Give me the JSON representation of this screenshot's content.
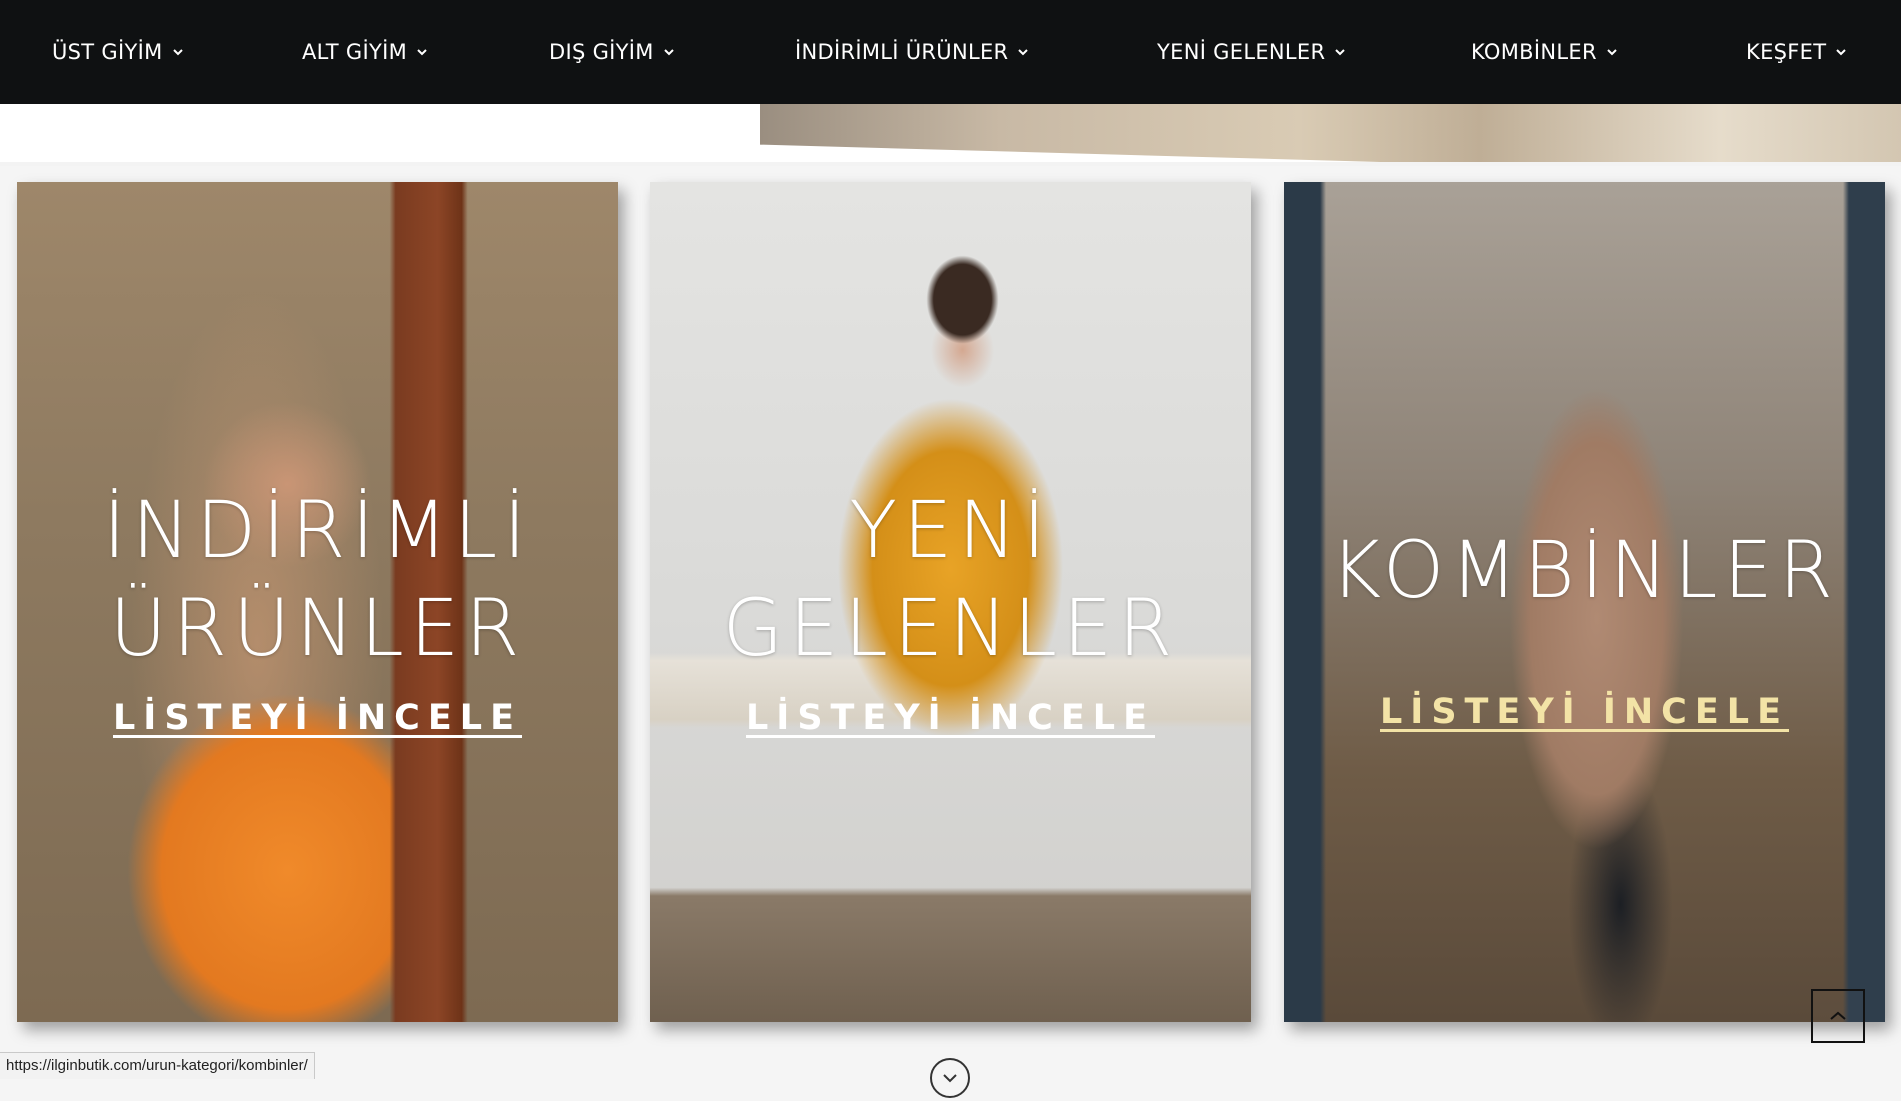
{
  "nav": {
    "items": [
      {
        "label": "ÜST GİYİM"
      },
      {
        "label": "ALT GİYİM"
      },
      {
        "label": "DIŞ GİYİM"
      },
      {
        "label": "İNDİRİMLİ ÜRÜNLER"
      },
      {
        "label": "YENİ GELENLER"
      },
      {
        "label": "KOMBİNLER"
      },
      {
        "label": "KEŞFET"
      }
    ],
    "chevron_icon": "chevron-down-icon",
    "background": "#0f1112"
  },
  "cards": [
    {
      "title": "İNDİRİMLİ\nÜRÜNLER",
      "link": "LİSTEYİ İNCELE",
      "link_color": "#ffffff"
    },
    {
      "title": "YENİ\nGELENLER",
      "link": "LİSTEYİ İNCELE",
      "link_color": "#ffffff"
    },
    {
      "title": "KOMBİNLER",
      "link": "LİSTEYİ İNCELE",
      "link_color": "#f3e3a6"
    }
  ],
  "status_bar": {
    "url": "https://ilginbutik.com/urun-kategori/kombinler/"
  },
  "controls": {
    "scroll_top_icon": "chevron-up-icon",
    "scroll_down_icon": "chevron-down-icon"
  }
}
